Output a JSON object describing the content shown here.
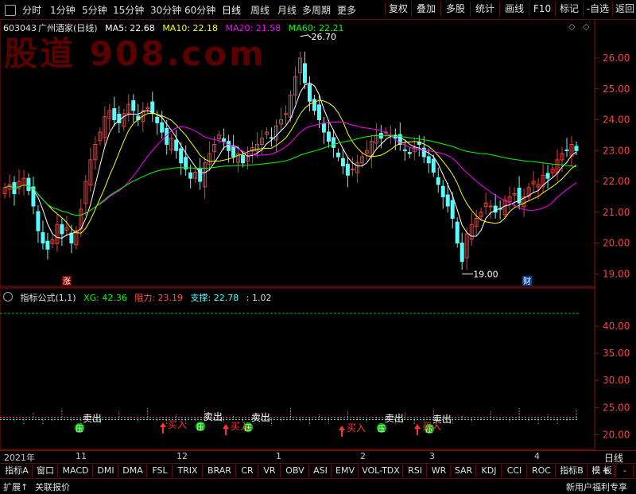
{
  "toolbar": {
    "timeframes": [
      "分时",
      "1分钟",
      "5分钟",
      "15分钟",
      "30分钟",
      "60分钟",
      "日线",
      "周线",
      "月线",
      "多周期",
      "更多"
    ],
    "right_buttons": [
      "复权",
      "叠加",
      "多股",
      "统计",
      "画线",
      "F10",
      "标记",
      "-自选",
      "返回"
    ]
  },
  "header": {
    "code": "603043",
    "name": "广州酒家(日线)",
    "ma5": "MA5: 22.68",
    "ma10": "MA10: 22.18",
    "ma20": "MA20: 21.58",
    "ma60": "MA60: 22.21",
    "watermark": "股道 908.com"
  },
  "price_axis": [
    "26.00",
    "25.00",
    "24.00",
    "23.00",
    "22.00",
    "21.00",
    "20.00",
    "19.00"
  ],
  "annotations": {
    "high": "26.70",
    "low": "19.00",
    "zhang": "涨",
    "cai": "财"
  },
  "indicator": {
    "title": "指标公式(1,1)",
    "xg": "XG: 42.36",
    "zuli": "阻力: 23.19",
    "zhicheng": "支撑: 22.78",
    "tail": ": 1.02",
    "axis": [
      "40.00",
      "35.00",
      "30.00",
      "25.00",
      "20.00"
    ],
    "sell_label": "卖出",
    "buy_label": "买入",
    "press_label": "压"
  },
  "dates": [
    "2021年",
    "11",
    "12",
    "1",
    "2",
    "3",
    "4"
  ],
  "period_label": "日线",
  "tabs": [
    "指标A",
    "窗口",
    "MACD",
    "DMI",
    "DMA",
    "FSL",
    "TRIX",
    "BRAR",
    "CR",
    "VR",
    "OBV",
    "ASI",
    "EMV",
    "VOL-TDX",
    "RSI",
    "WR",
    "SAR",
    "KDJ",
    "CCI",
    "ROC",
    "指标B",
    "模 板"
  ],
  "tab_controls": [
    "+",
    "-"
  ],
  "status": {
    "left1": "扩展↑",
    "left2": "关联报价",
    "right": "新用户福利专享"
  },
  "colors": {
    "up": "#ff3232",
    "down": "#54ffff",
    "ma5": "#ffffff",
    "ma10": "#ffff00",
    "ma20": "#ff00ff",
    "ma60": "#00ff00",
    "grid": "#8a1414"
  },
  "chart_data": {
    "type": "candlestick",
    "ylim": [
      18.8,
      26.8
    ],
    "closes": [
      21.8,
      21.9,
      21.6,
      22.0,
      22.1,
      21.7,
      21.2,
      20.4,
      20.0,
      19.8,
      20.1,
      20.6,
      20.3,
      20.5,
      20.0,
      20.4,
      21.1,
      22.0,
      22.7,
      23.2,
      23.6,
      24.1,
      24.3,
      24.0,
      23.9,
      24.2,
      24.5,
      24.3,
      24.0,
      24.3,
      24.4,
      24.2,
      23.9,
      23.6,
      23.2,
      23.4,
      23.0,
      22.6,
      22.4,
      22.1,
      22.3,
      22.0,
      22.6,
      22.9,
      23.2,
      23.5,
      23.3,
      23.0,
      22.8,
      22.9,
      22.6,
      22.8,
      23.1,
      23.2,
      23.4,
      23.6,
      23.4,
      23.8,
      24.0,
      24.2,
      24.8,
      25.4,
      26.0,
      25.2,
      24.6,
      24.3,
      24.0,
      23.6,
      23.3,
      23.1,
      22.8,
      22.5,
      22.2,
      22.4,
      22.6,
      22.8,
      23.0,
      23.3,
      23.5,
      23.4,
      23.6,
      23.5,
      23.4,
      23.2,
      23.0,
      22.9,
      23.1,
      23.2,
      22.8,
      22.6,
      22.3,
      21.9,
      21.5,
      21.2,
      20.8,
      20.0,
      19.4,
      20.3,
      20.6,
      20.8,
      21.0,
      21.3,
      21.2,
      21.0,
      21.1,
      21.4,
      21.5,
      21.6,
      21.3,
      21.5,
      21.8,
      22.0,
      21.9,
      22.2,
      22.1,
      22.4,
      22.7,
      22.9,
      23.0,
      23.2,
      23.0
    ]
  }
}
